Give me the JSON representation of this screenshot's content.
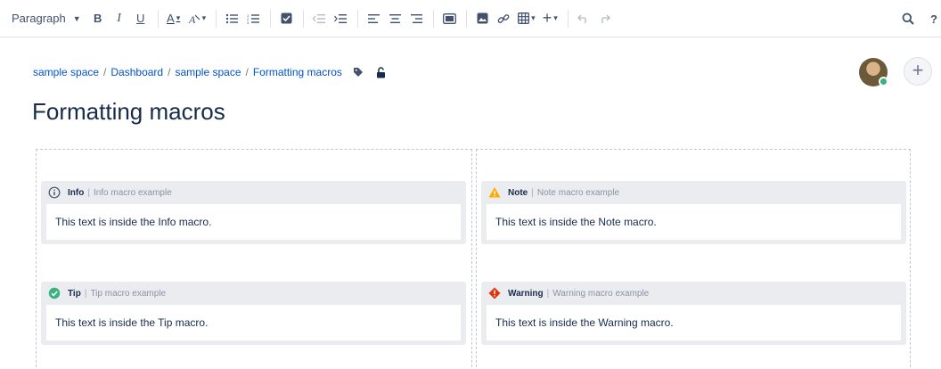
{
  "toolbar": {
    "paragraph_label": "Paragraph"
  },
  "breadcrumb": {
    "items": [
      "sample space",
      "Dashboard",
      "sample space",
      "Formatting macros"
    ],
    "separator": "/"
  },
  "page": {
    "title": "Formatting macros"
  },
  "add_button_label": "+",
  "macros": {
    "info": {
      "name": "Info",
      "desc": "Info macro example",
      "body": "This text is inside the Info macro.",
      "color": "#42526e"
    },
    "note": {
      "name": "Note",
      "desc": "Note macro example",
      "body": "This text is inside the Note macro.",
      "color": "#ffab00"
    },
    "tip": {
      "name": "Tip",
      "desc": "Tip macro example",
      "body": "This text is inside the Tip macro.",
      "color": "#36b37e"
    },
    "warning": {
      "name": "Warning",
      "desc": "Warning macro example",
      "body": "This text is inside the Warning macro.",
      "color": "#de350b"
    }
  },
  "colors": {
    "link": "#0052cc",
    "text": "#172b4d",
    "panel_bg": "#ebecf0",
    "presence": "#36b37e"
  }
}
